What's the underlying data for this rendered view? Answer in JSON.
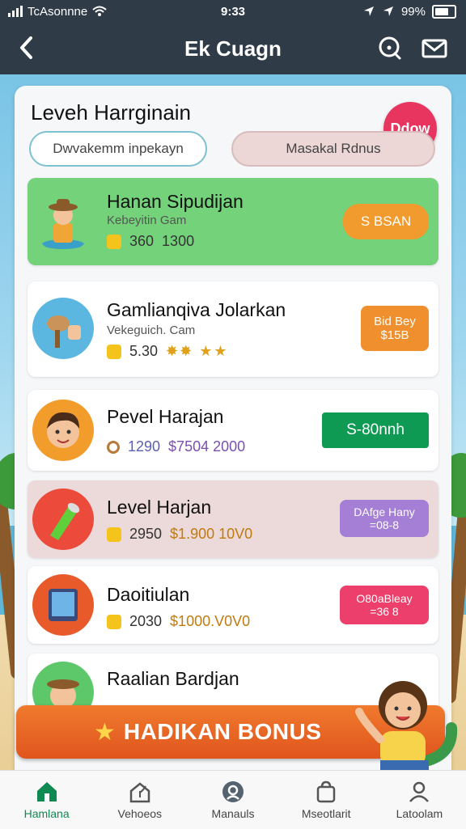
{
  "status": {
    "carrier": "TcAsonnne",
    "time": "9:33",
    "battery": "99%"
  },
  "header": {
    "title": "Ek Cuagn",
    "back_icon": "chevron-left-icon",
    "right_icons": [
      "help-icon",
      "mail-icon"
    ]
  },
  "panel": {
    "title": "Leveh Harrginain",
    "badge": "Ddow",
    "search_placeholder": "Dwvakemm inpekayn",
    "bonus_pill": "Masakal Rdnus"
  },
  "rows": [
    {
      "name": "Hanan Sipudijan",
      "sub": "Kebeyitin Gam",
      "stat_a": "360",
      "stat_b": "1300",
      "action": "S BSAN",
      "action_color": "#f19a2d",
      "bg": "#74d27a"
    },
    {
      "name": "Gamlianqiva Jolarkan",
      "sub": "Vekeguich. Cam",
      "stat_a": "5.30",
      "stat_b": "",
      "action": "Bid Bey\n$15B",
      "action_color": "#f08f2d",
      "bg": "#ffffff"
    },
    {
      "name": "Pevel Harajan",
      "sub": "",
      "stat_a": "1290",
      "stat_b": "$7504 2000",
      "action": "S-80nnh",
      "action_color": "#0e9a52",
      "bg": "#ffffff"
    },
    {
      "name": "Level Harjan",
      "sub": "",
      "stat_a": "2950",
      "stat_b": "$1.900 10V0",
      "action": "DAfge Hany\n=08-8",
      "action_color": "#a57ed6",
      "bg": "#ecdada"
    },
    {
      "name": "Daoitiulan",
      "sub": "",
      "stat_a": "2030",
      "stat_b": "$1000.V0V0",
      "action": "O80aBleay\n=36 8",
      "action_color": "#ec3f6b",
      "bg": "#ffffff"
    },
    {
      "name": "Raalian Bardjan",
      "sub": "",
      "stat_a": "",
      "stat_b": "",
      "action": "",
      "action_color": "",
      "bg": "#ffffff"
    }
  ],
  "bonus_banner": {
    "label": "HADIKAN BONUS",
    "icon": "star-icon"
  },
  "nav": [
    {
      "label": "Hamlana",
      "icon": "home-icon",
      "active": true
    },
    {
      "label": "Vehoeos",
      "icon": "house-plant-icon",
      "active": false
    },
    {
      "label": "Manauls",
      "icon": "profile-circle-icon",
      "active": false
    },
    {
      "label": "Mseotlarit",
      "icon": "bag-icon",
      "active": false
    },
    {
      "label": "Latoolam",
      "icon": "user-icon",
      "active": false
    }
  ],
  "colors": {
    "header_bg": "#2f3b46",
    "accent_green": "#0e8a52",
    "banner_orange": "#e86426"
  }
}
